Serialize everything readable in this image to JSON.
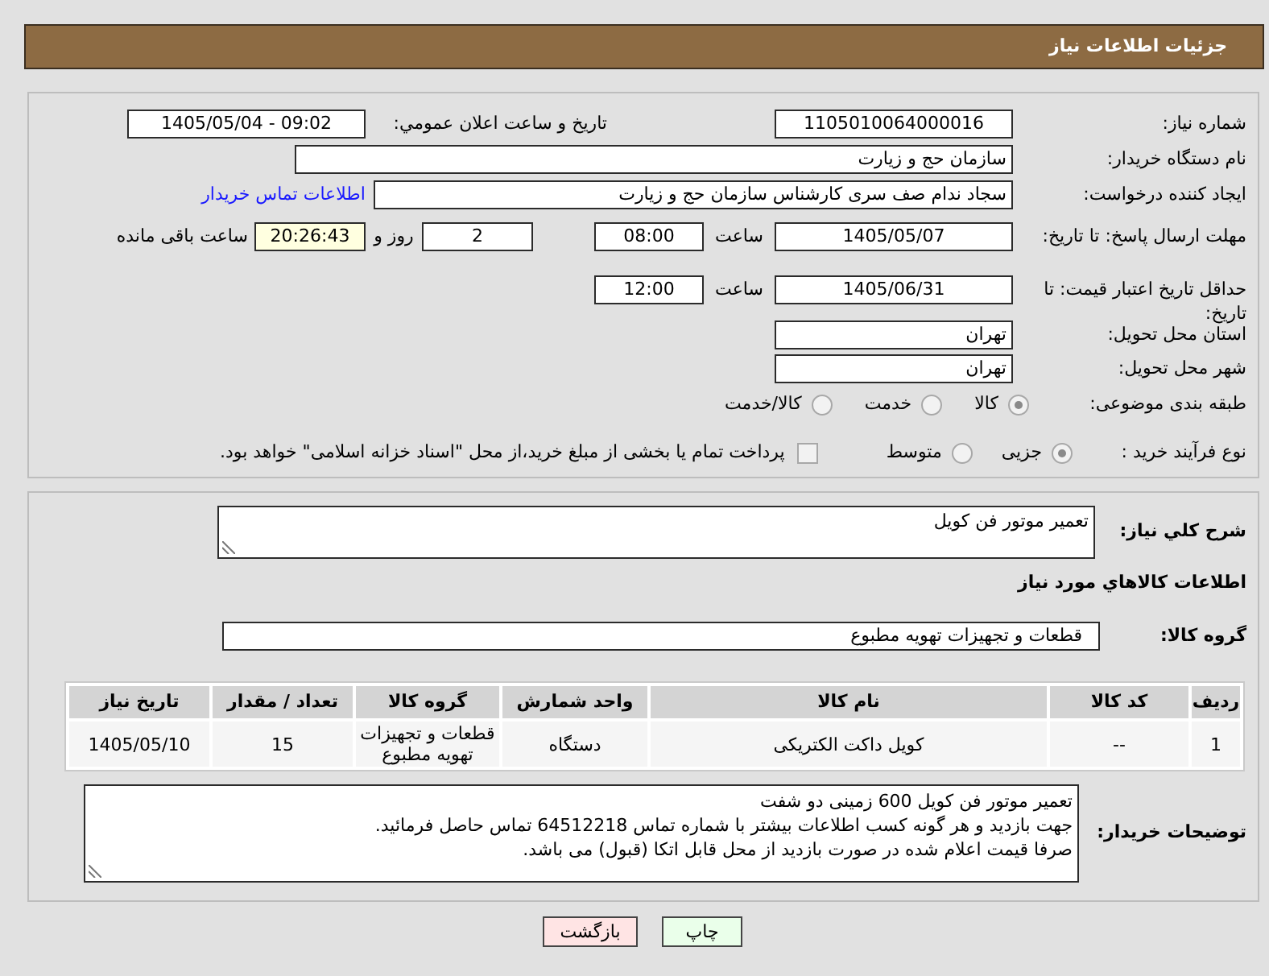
{
  "header": {
    "title": "جزئیات اطلاعات نیاز"
  },
  "details": {
    "need_number": {
      "label": "شماره نیاز:",
      "value": "1105010064000016"
    },
    "announce": {
      "label": "تاریخ و ساعت اعلان عمومي:",
      "value": "1405/05/04 - 09:02"
    },
    "buyer_org": {
      "label": "نام دستگاه خریدار:",
      "value": "سازمان حج و زیارت"
    },
    "requester": {
      "label": "ایجاد کننده درخواست:",
      "value": "سجاد ندام صف سری کارشناس سازمان حج و زیارت",
      "contact_link": "اطلاعات تماس خریدار"
    },
    "response_deadline": {
      "label": "مهلت ارسال پاسخ: تا تاریخ:",
      "date": "1405/05/07",
      "time_label": "ساعت",
      "time": "08:00",
      "days": "2",
      "days_label": "روز و",
      "remaining": "20:26:43",
      "remaining_label": "ساعت باقی مانده"
    },
    "price_validity": {
      "label": "حداقل تاریخ اعتبار قیمت: تا تاریخ:",
      "date": "1405/06/31",
      "time_label": "ساعت",
      "time": "12:00"
    },
    "province": {
      "label": "استان محل تحویل:",
      "value": "تهران"
    },
    "city": {
      "label": "شهر محل تحویل:",
      "value": "تهران"
    },
    "category": {
      "label": "طبقه بندی موضوعی:",
      "options": [
        {
          "label": "کالا",
          "selected": true
        },
        {
          "label": "خدمت",
          "selected": false
        },
        {
          "label": "کالا/خدمت",
          "selected": false
        }
      ]
    },
    "process": {
      "label": "نوع فرآیند خرید :",
      "options": [
        {
          "label": "جزیی",
          "selected": true
        },
        {
          "label": "متوسط",
          "selected": false
        }
      ],
      "treasury": {
        "label": "پرداخت تمام یا بخشی از مبلغ خرید،از محل \"اسناد خزانه اسلامی\" خواهد بود.",
        "checked": false
      }
    }
  },
  "need": {
    "summary": {
      "label": "شرح كلي نياز:",
      "value": "تعمیر موتور فن کویل"
    },
    "goods_title": "اطلاعات كالاهاي مورد نياز",
    "goods_group": {
      "label": "گروه کالا:",
      "value": "قطعات و تجهیزات تهویه مطبوع"
    },
    "table": {
      "columns": [
        "ردیف",
        "کد کالا",
        "نام کالا",
        "واحد شمارش",
        "گروه کالا",
        "تعداد / مقدار",
        "تاریخ نیاز"
      ],
      "rows": [
        [
          "1",
          "--",
          "کویل داکت الکتریکی",
          "دستگاه",
          "قطعات و تجهیزات تهویه مطبوع",
          "15",
          "1405/05/10"
        ]
      ]
    },
    "buyer_notes": {
      "label": "توضیحات خریدار:",
      "lines": [
        "تعمیر موتور فن کویل 600 زمینی دو شفت",
        "جهت بازدید و هر گونه کسب اطلاعات بیشتر با شماره تماس 64512218 تماس حاصل فرمائید.",
        "صرفا قیمت اعلام شده در صورت بازدید از محل قابل اتکا (قبول) می باشد."
      ]
    }
  },
  "buttons": [
    {
      "label": "چاپ",
      "kind": "print"
    },
    {
      "label": "بازگشت",
      "kind": "back"
    }
  ]
}
